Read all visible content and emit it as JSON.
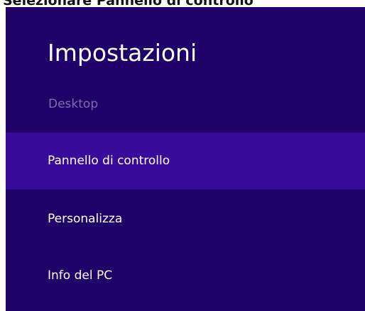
{
  "caption": "Selezionare Pannello di controllo",
  "settings": {
    "title": "Impostazioni",
    "section_label": "Desktop",
    "items": [
      {
        "label": "Pannello di controllo",
        "selected": true
      },
      {
        "label": "Personalizza",
        "selected": false
      },
      {
        "label": "Info del PC",
        "selected": false
      }
    ]
  },
  "colors": {
    "panel_bg": "#1f0068",
    "selected_bg": "#3a0a9b",
    "section_label": "#7e6cae",
    "text": "#ffffff"
  }
}
